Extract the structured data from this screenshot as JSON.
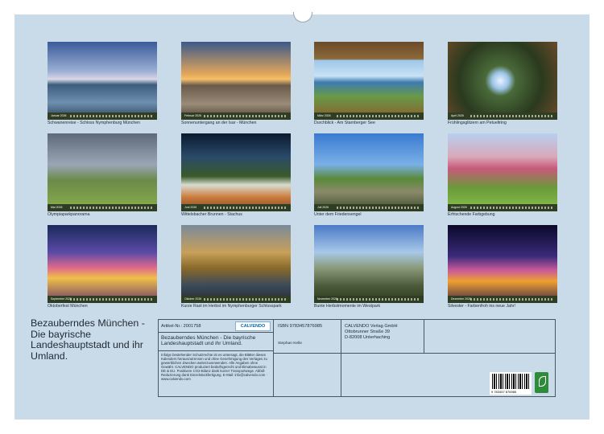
{
  "calendar": {
    "months": [
      {
        "month": "Januar 2026",
        "caption": "Schwanenreise - Schloss Nymphenburg München"
      },
      {
        "month": "Februar 2026",
        "caption": "Sonnenuntergang an der Isar - München"
      },
      {
        "month": "März 2026",
        "caption": "Durchblick - Am Starnberger See"
      },
      {
        "month": "April 2026",
        "caption": "Frühlingsglitzern am Petueltring"
      },
      {
        "month": "Mai 2026",
        "caption": "Olympiaparkpanorama"
      },
      {
        "month": "Juni 2026",
        "caption": "Wittelsbacher Brunnen - Stachus"
      },
      {
        "month": "Juli 2026",
        "caption": "Unter dem Friedensengel"
      },
      {
        "month": "August 2026",
        "caption": "Erfrischende Farbgebung"
      },
      {
        "month": "September 2026",
        "caption": "Oktoberfest München"
      },
      {
        "month": "Oktober 2026",
        "caption": "Kurze Rast im Herbst im Nymphenburger Schlosspark"
      },
      {
        "month": "November 2026",
        "caption": "Bunte Herbstmomente im Westpark"
      },
      {
        "month": "Dezember 2026",
        "caption": "Silvester - Farbenfroh ins neue Jahr!"
      }
    ]
  },
  "info": {
    "title": "Bezauberndes München - Die bayrische Landeshauptstadt und ihr Umland.",
    "article_label": "Artikel-Nr.: 2001758",
    "logo_text": "CALVENDO",
    "subtitle": "Bezauberndes München - Die bayrische Landeshauptstadt und ihr Umland.",
    "legal": "Infolge bestehender Schutzrechte ist es untersagt, die Blätter dieses Kalenders herauszutrennen und ohne Genehmigung des Verlages zu gewerblichen Zwecken weiterzuverwenden. Alle Angaben ohne Gewähr. CALVENDO produziert bedarfsgerecht und klimabewusst in DE & EU. Positivere CO2-Bilanz dank kurzer Transportwege. Abfall-Reduzierung dank Einzelstückfertigung. E-Mail: info@calvendo.com · www.calvendo.com",
    "isbn": "ISBN 9783457876985",
    "author": "Stephan Kelle",
    "publisher_lines": [
      "CALVENDO Verlag GmbH",
      "Ottobrunner Straße 39",
      "D-82008 Unterhaching"
    ],
    "barcode_number": "9 783457 876985"
  },
  "colors": {
    "page": "#c9dae8",
    "strip": "#2f3e22",
    "border": "#4a5560",
    "logo": "#0069b4"
  }
}
